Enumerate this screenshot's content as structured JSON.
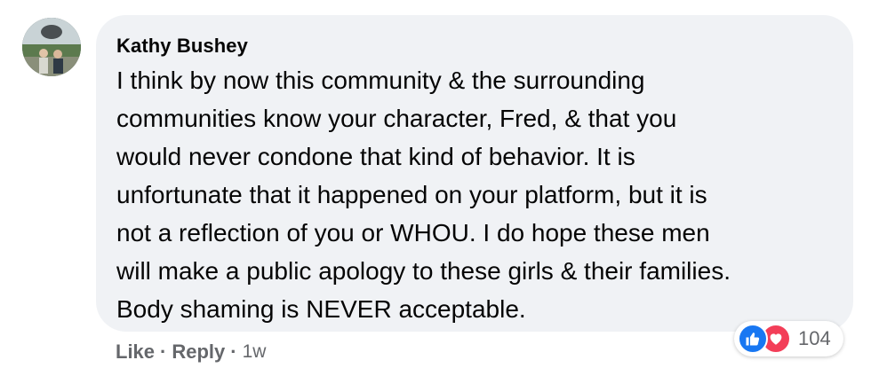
{
  "comment": {
    "author": "Kathy Bushey",
    "text": "I think by now this community & the surrounding\ncommunities know your character, Fred, & that you\nwould never condone that kind of behavior. It is\nunfortunate that it happened on your platform, but it is\nnot a reflection of you or WHOU. I do hope these men\nwill make a public apology to these girls & their families.\nBody shaming is NEVER acceptable."
  },
  "actions": {
    "like_label": "Like",
    "reply_label": "Reply",
    "separator": "·",
    "timestamp": "1w"
  },
  "reactions": {
    "types": [
      "like-icon",
      "love-icon"
    ],
    "count": "104",
    "colors": {
      "like": "#1877f2",
      "love": "#f33e58"
    }
  },
  "theme": {
    "bubble_bg": "#f0f2f5",
    "text_color": "#050505",
    "secondary_text": "#65676b"
  }
}
